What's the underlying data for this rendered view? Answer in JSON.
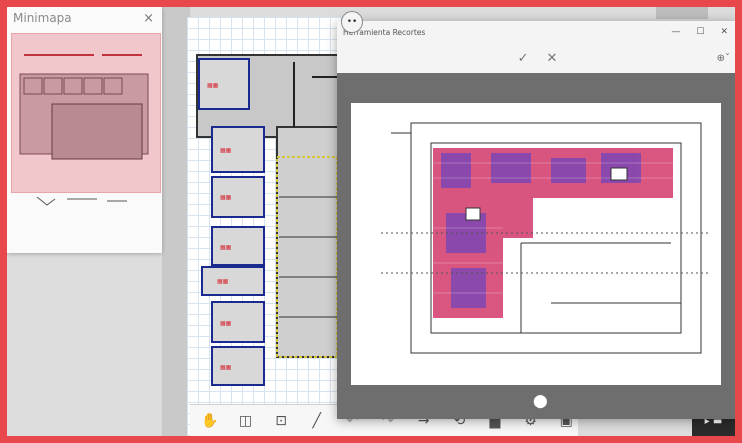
{
  "minimap": {
    "title": "Minimapa",
    "close": "×"
  },
  "tool_window": {
    "title": "Herramienta Recortes",
    "controls": {
      "minimize": "—",
      "maximize": "☐",
      "close": "✕"
    },
    "confirm": "✓",
    "cancel": "✕",
    "zoom": "⊕ˇ"
  },
  "top_button": "••",
  "toolbar": {
    "items": [
      "pan-hand",
      "camera",
      "screenshot",
      "pen",
      "undo",
      "redo",
      "arrow",
      "rotate",
      "trash",
      "settings",
      "layers"
    ]
  },
  "right_tab_label": "▸ ▬",
  "colors": {
    "frame": "#e8474b",
    "blueprint_red": "#d23a5a",
    "blueprint_blue": "#2a2f9e",
    "minimap_fill": "#f2c7cc"
  }
}
